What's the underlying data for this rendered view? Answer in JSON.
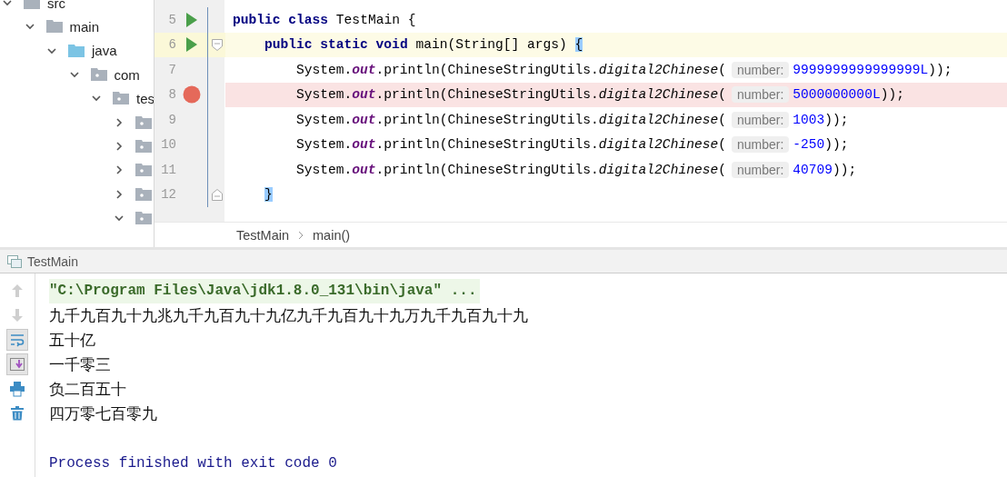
{
  "project_tree": {
    "items": [
      {
        "label": "src",
        "kind": "folder",
        "expanded": true,
        "children": [
          {
            "label": "main",
            "kind": "folder",
            "expanded": true,
            "children": [
              {
                "label": "java",
                "kind": "source-root",
                "expanded": true,
                "children": [
                  {
                    "label": "com",
                    "kind": "package",
                    "expanded": true,
                    "children": [
                      {
                        "label": "tes",
                        "kind": "package",
                        "expanded": true,
                        "children": [
                          {
                            "kind": "package",
                            "expanded": false
                          },
                          {
                            "kind": "package",
                            "expanded": false
                          },
                          {
                            "kind": "package",
                            "expanded": false
                          },
                          {
                            "kind": "package",
                            "expanded": false
                          },
                          {
                            "kind": "package",
                            "expanded": true
                          }
                        ]
                      }
                    ]
                  }
                ]
              }
            ]
          }
        ]
      }
    ]
  },
  "editor": {
    "lines": [
      {
        "number": "5",
        "kind": "class",
        "run_marker": true,
        "breakpoint": false,
        "current": false,
        "fold_start": false,
        "fold_end": false,
        "tokens": [
          {
            "kind": "keyword",
            "text": "public class "
          },
          {
            "kind": "plain",
            "text": "TestMain {"
          }
        ]
      },
      {
        "number": "6",
        "kind": "method",
        "run_marker": true,
        "breakpoint": false,
        "current": true,
        "fold_start": true,
        "fold_end": false,
        "tokens": [
          {
            "kind": "keyword",
            "text": "public static void "
          },
          {
            "kind": "plain",
            "text": "main(String[] args) "
          },
          {
            "kind": "brace-match",
            "text": "{"
          }
        ]
      },
      {
        "number": "7",
        "kind": "statement",
        "run_marker": false,
        "breakpoint": false,
        "current": false,
        "fold_start": false,
        "fold_end": false,
        "tokens": [
          {
            "kind": "plain",
            "text": "System."
          },
          {
            "kind": "static-field",
            "text": "out"
          },
          {
            "kind": "plain",
            "text": ".println(ChineseStringUtils."
          },
          {
            "kind": "static-method",
            "text": "digital2Chinese"
          },
          {
            "kind": "plain",
            "text": "("
          },
          {
            "kind": "hint",
            "text": "number:"
          },
          {
            "kind": "number",
            "text": "9999999999999999L"
          },
          {
            "kind": "plain",
            "text": "));"
          }
        ]
      },
      {
        "number": "8",
        "kind": "statement",
        "run_marker": false,
        "breakpoint": true,
        "current": false,
        "fold_start": false,
        "fold_end": false,
        "tokens": [
          {
            "kind": "plain",
            "text": "System."
          },
          {
            "kind": "static-field",
            "text": "out"
          },
          {
            "kind": "plain",
            "text": ".println(ChineseStringUtils."
          },
          {
            "kind": "static-method",
            "text": "digital2Chinese"
          },
          {
            "kind": "plain",
            "text": "("
          },
          {
            "kind": "hint",
            "text": "number:"
          },
          {
            "kind": "number",
            "text": "5000000000L"
          },
          {
            "kind": "plain",
            "text": "));"
          }
        ]
      },
      {
        "number": "9",
        "kind": "statement",
        "run_marker": false,
        "breakpoint": false,
        "current": false,
        "fold_start": false,
        "fold_end": false,
        "tokens": [
          {
            "kind": "plain",
            "text": "System."
          },
          {
            "kind": "static-field",
            "text": "out"
          },
          {
            "kind": "plain",
            "text": ".println(ChineseStringUtils."
          },
          {
            "kind": "static-method",
            "text": "digital2Chinese"
          },
          {
            "kind": "plain",
            "text": "("
          },
          {
            "kind": "hint",
            "text": "number:"
          },
          {
            "kind": "number",
            "text": "1003"
          },
          {
            "kind": "plain",
            "text": "));"
          }
        ]
      },
      {
        "number": "10",
        "kind": "statement",
        "run_marker": false,
        "breakpoint": false,
        "current": false,
        "fold_start": false,
        "fold_end": false,
        "tokens": [
          {
            "kind": "plain",
            "text": "System."
          },
          {
            "kind": "static-field",
            "text": "out"
          },
          {
            "kind": "plain",
            "text": ".println(ChineseStringUtils."
          },
          {
            "kind": "static-method",
            "text": "digital2Chinese"
          },
          {
            "kind": "plain",
            "text": "("
          },
          {
            "kind": "hint",
            "text": "number:"
          },
          {
            "kind": "number",
            "text": "-250"
          },
          {
            "kind": "plain",
            "text": "));"
          }
        ]
      },
      {
        "number": "11",
        "kind": "statement",
        "run_marker": false,
        "breakpoint": false,
        "current": false,
        "fold_start": false,
        "fold_end": false,
        "tokens": [
          {
            "kind": "plain",
            "text": "System."
          },
          {
            "kind": "static-field",
            "text": "out"
          },
          {
            "kind": "plain",
            "text": ".println(ChineseStringUtils."
          },
          {
            "kind": "static-method",
            "text": "digital2Chinese"
          },
          {
            "kind": "plain",
            "text": "("
          },
          {
            "kind": "hint",
            "text": "number:"
          },
          {
            "kind": "number",
            "text": "40709"
          },
          {
            "kind": "plain",
            "text": "));"
          }
        ]
      },
      {
        "number": "12",
        "kind": "method",
        "run_marker": false,
        "breakpoint": false,
        "current": false,
        "fold_start": false,
        "fold_end": true,
        "tokens": [
          {
            "kind": "brace-match",
            "text": "}"
          }
        ]
      }
    ]
  },
  "breadcrumbs": [
    "TestMain",
    "main()"
  ],
  "run_panel": {
    "title": "TestMain",
    "toolbar": [
      {
        "kind": "up",
        "disabled": true,
        "selected": false
      },
      {
        "kind": "down",
        "disabled": true,
        "selected": false
      },
      {
        "kind": "soft-wrap",
        "disabled": false,
        "selected": true
      },
      {
        "kind": "scroll-end",
        "disabled": false,
        "selected": true
      },
      {
        "kind": "print",
        "disabled": false,
        "selected": false
      },
      {
        "kind": "trash",
        "disabled": false,
        "selected": false
      }
    ],
    "output": [
      {
        "kind": "command",
        "text": "\"C:\\Program Files\\Java\\jdk1.8.0_131\\bin\\java\" ..."
      },
      {
        "kind": "stdout",
        "text": "九千九百九十九兆九千九百九十九亿九千九百九十九万九千九百九十九"
      },
      {
        "kind": "stdout",
        "text": "五十亿"
      },
      {
        "kind": "stdout",
        "text": "一千零三"
      },
      {
        "kind": "stdout",
        "text": "负二百五十"
      },
      {
        "kind": "stdout",
        "text": "四万零七百零九"
      },
      {
        "kind": "exit",
        "text": "Process finished with exit code 0"
      }
    ]
  }
}
